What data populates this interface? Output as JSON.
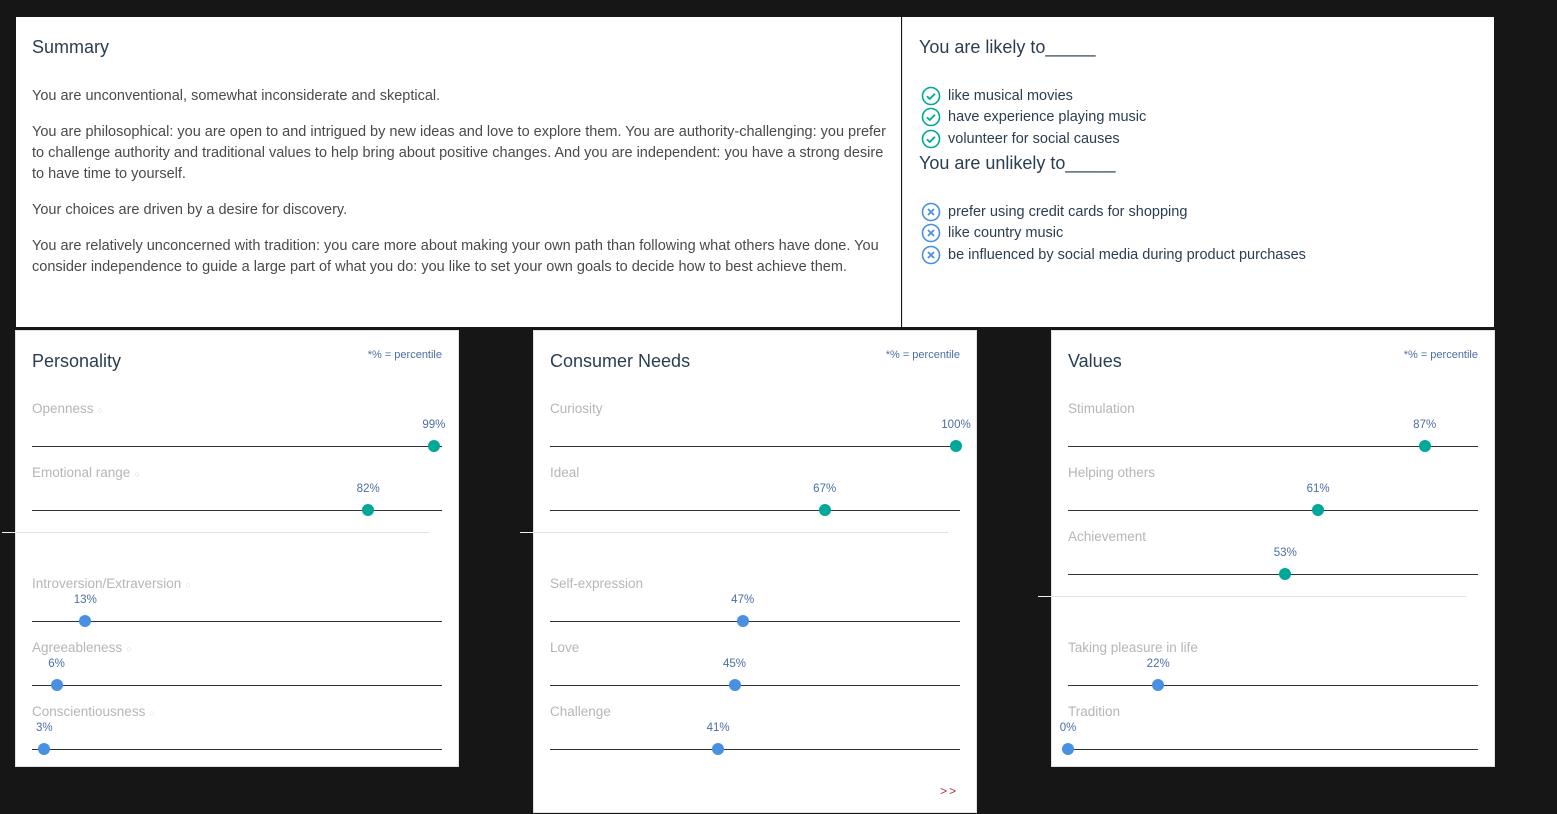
{
  "summary": {
    "title": "Summary",
    "paragraphs": [
      "You are unconventional, somewhat inconsiderate and skeptical.",
      "You are philosophical: you are open to and intrigued by new ideas and love to explore them. You are authority-challenging: you prefer to challenge authority and traditional values to help bring about positive changes. And you are independent: you have a strong desire to have time to yourself.",
      "Your choices are driven by a desire for discovery.",
      "You are relatively unconcerned with tradition: you care more about making your own path than following what others have done. You consider independence to guide a large part of what you do: you like to set your own goals to decide how to best achieve them."
    ]
  },
  "likely": {
    "title": "You are likely to_____",
    "items": [
      "like musical movies",
      "have experience playing music",
      "volunteer for social causes"
    ]
  },
  "unlikely": {
    "title": "You are unlikely to_____",
    "items": [
      "prefer using credit cards for shopping",
      "like country music",
      "be influenced by social media during product purchases"
    ]
  },
  "colors": {
    "high": "#00a89a",
    "low": "#4a90e2",
    "title": "#2b3e50"
  },
  "personality": {
    "title": "Personality",
    "note": "*% = percentile",
    "high": [
      {
        "label": "Openness",
        "value": 99,
        "pct": "99%"
      },
      {
        "label": "Emotional range",
        "value": 82,
        "pct": "82%"
      }
    ],
    "low": [
      {
        "label": "Introversion/Extraversion",
        "value": 13,
        "pct": "13%"
      },
      {
        "label": "Agreeableness",
        "value": 6,
        "pct": "6%"
      },
      {
        "label": "Conscientiousness",
        "value": 3,
        "pct": "3%"
      }
    ]
  },
  "needs": {
    "title": "Consumer Needs",
    "note": "*% = percentile",
    "more": ">>",
    "high": [
      {
        "label": "Curiosity",
        "value": 100,
        "pct": "100%"
      },
      {
        "label": "Ideal",
        "value": 67,
        "pct": "67%"
      }
    ],
    "low": [
      {
        "label": "Self-expression",
        "value": 47,
        "pct": "47%"
      },
      {
        "label": "Love",
        "value": 45,
        "pct": "45%"
      },
      {
        "label": "Challenge",
        "value": 41,
        "pct": "41%"
      }
    ]
  },
  "values": {
    "title": "Values",
    "note": "*% = percentile",
    "high": [
      {
        "label": "Stimulation",
        "value": 87,
        "pct": "87%"
      },
      {
        "label": "Helping others",
        "value": 61,
        "pct": "61%"
      },
      {
        "label": "Achievement",
        "value": 53,
        "pct": "53%"
      }
    ],
    "low": [
      {
        "label": "Taking pleasure in life",
        "value": 22,
        "pct": "22%"
      },
      {
        "label": "Tradition",
        "value": 0,
        "pct": "0%"
      }
    ]
  }
}
